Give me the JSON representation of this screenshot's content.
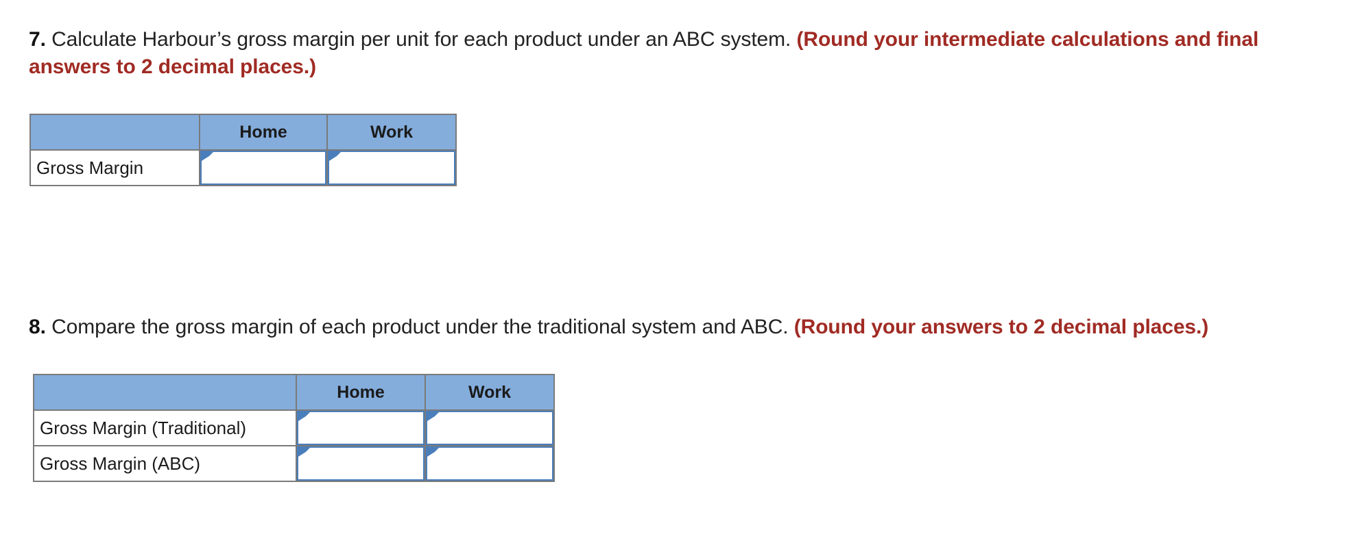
{
  "colors": {
    "header_fill": "#84addc",
    "grid_border": "#7a7a7a",
    "input_border": "#4a7ebb",
    "note_red": "#a02b24",
    "body_text": "#222222",
    "page_background": "#ffffff"
  },
  "questions": [
    {
      "number": "7.",
      "body": " Calculate Harbour’s gross margin per unit for each product under an ABC system. ",
      "note": "(Round your intermediate calculations and final answers to 2 decimal places.)"
    },
    {
      "number": "8.",
      "body": " Compare the gross margin of each product under the traditional system and ABC. ",
      "note": "(Round your answers to 2 decimal places.)"
    }
  ],
  "tables": [
    {
      "id": "table-7",
      "corner_header": "",
      "columns": [
        "Home",
        "Work"
      ],
      "rows": [
        {
          "label": "Gross Margin",
          "cells": [
            {
              "value": "",
              "placeholder": ""
            },
            {
              "value": "",
              "placeholder": ""
            }
          ]
        }
      ]
    },
    {
      "id": "table-8",
      "corner_header": "",
      "columns": [
        "Home",
        "Work"
      ],
      "rows": [
        {
          "label": "Gross Margin (Traditional)",
          "cells": [
            {
              "value": "",
              "placeholder": ""
            },
            {
              "value": "",
              "placeholder": ""
            }
          ]
        },
        {
          "label": "Gross Margin (ABC)",
          "cells": [
            {
              "value": "",
              "placeholder": ""
            },
            {
              "value": "",
              "placeholder": ""
            }
          ]
        }
      ]
    }
  ]
}
